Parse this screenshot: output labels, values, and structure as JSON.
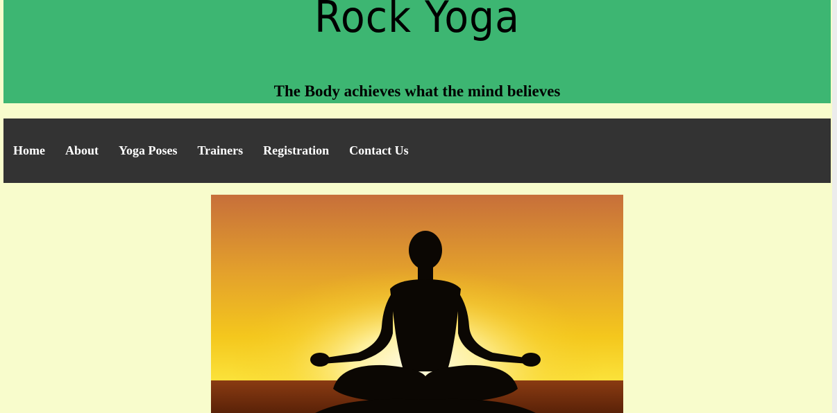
{
  "header": {
    "title": "Rock Yoga",
    "tagline": "The Body achieves what the mind believes",
    "background": "#3db672"
  },
  "nav": {
    "background": "#333333",
    "items": [
      {
        "label": "Home"
      },
      {
        "label": "About"
      },
      {
        "label": "Yoga Poses"
      },
      {
        "label": "Trainers"
      },
      {
        "label": "Registration"
      },
      {
        "label": "Contact Us"
      }
    ]
  },
  "page": {
    "background": "#f8fccc"
  },
  "hero": {
    "image": "meditation-silhouette-sunset"
  }
}
